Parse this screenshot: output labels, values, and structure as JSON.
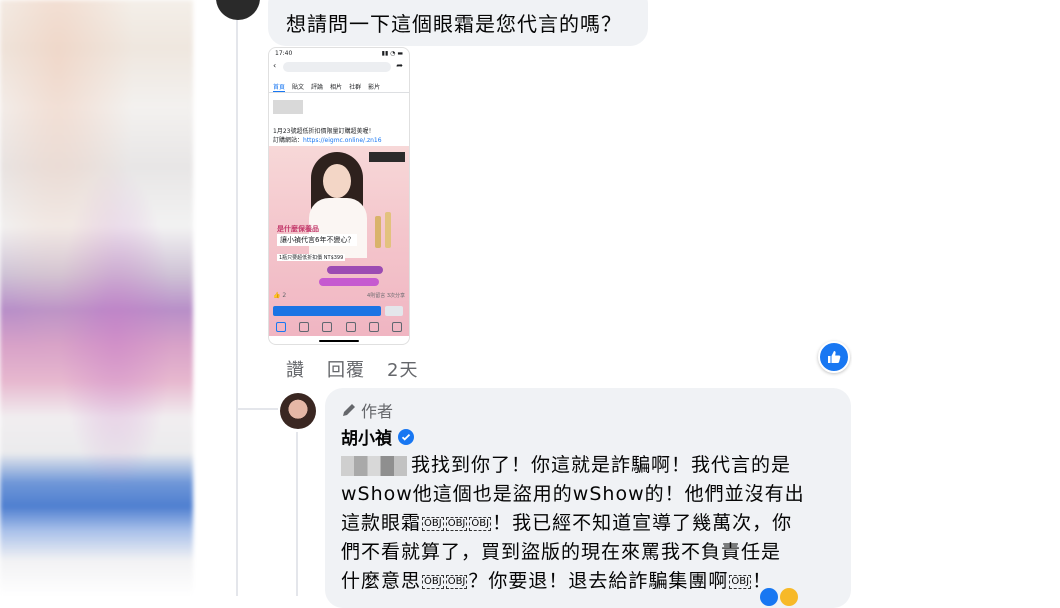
{
  "top_comment": {
    "text": "想請問一下這個眼霜是您代言的嗎？"
  },
  "attachment": {
    "status_time": "17:40",
    "tabs": [
      "首頁",
      "貼文",
      "評論",
      "相片",
      "社群",
      "影片"
    ],
    "post_line1": "1月23號超低折扣價限量訂購超美喔！",
    "post_line2_prefix": "訂購網站：",
    "post_line2_link": "https://eigmc.online/.zn16",
    "ad_caption1": "是什麼保養品",
    "ad_caption2": "讓小禎代言6年不變心？",
    "ad_caption3": "1瓶只要超低折扣價 NT$399",
    "reactions_count": "2",
    "comments_shares": "4則留言 3次分享"
  },
  "actions": {
    "like_label": "讚",
    "reply_label": "回覆",
    "age": "2天"
  },
  "icons": {
    "like": "thumbs-up-icon",
    "author": "pencil-icon",
    "verified": "verified-badge-icon"
  },
  "reply": {
    "author_badge": "作者",
    "name": "胡小禎",
    "line1": "我找到你了！你這就是詐騙啊！我代言的是",
    "line2": "wShow他這個也是盜用的wShow的！他們並沒有出",
    "line3a": "這款眼霜",
    "line3b": "！我已經不知道宣導了幾萬次，你",
    "line4": "們不看就算了，買到盜版的現在來罵我不負責任是",
    "line5a": "什麼意思",
    "line5b": "？你要退！退去給詐騙集團啊",
    "line5c": "！",
    "obj_token": "OBJ"
  },
  "colors": {
    "facebook_blue": "#1877f2",
    "bubble_bg": "#f0f2f5",
    "meta_grey": "#65676b"
  }
}
